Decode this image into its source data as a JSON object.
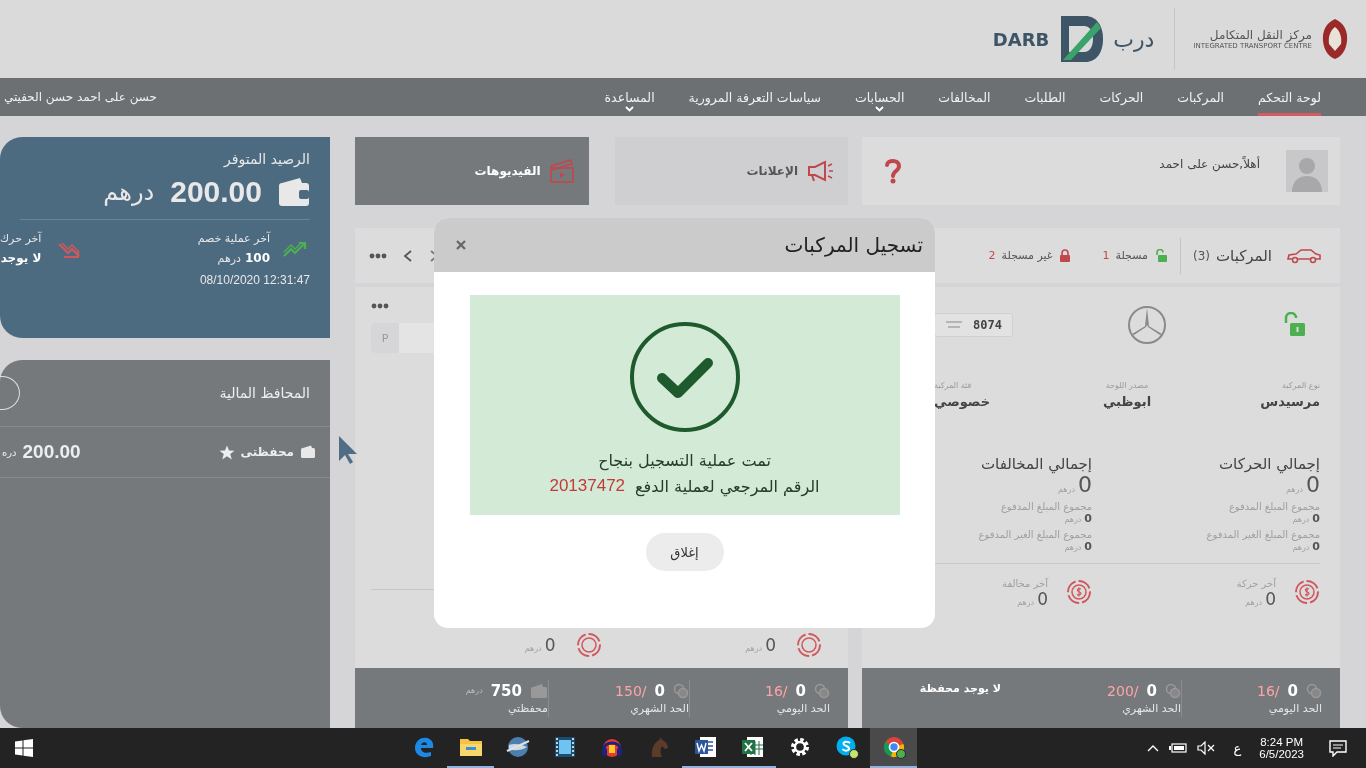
{
  "header": {
    "darb_latin": "DARB",
    "darb_arabic": "درب",
    "itc_arabic": "مركز النقل المتكامل",
    "itc_english": "INTEGRATED TRANSPORT CENTRE"
  },
  "nav": {
    "items": [
      {
        "label": "لوحة التحكم",
        "selected": true,
        "dropdown": false
      },
      {
        "label": "المركبات",
        "selected": false,
        "dropdown": false
      },
      {
        "label": "الحركات",
        "selected": false,
        "dropdown": false
      },
      {
        "label": "الطلبات",
        "selected": false,
        "dropdown": false
      },
      {
        "label": "المخالفات",
        "selected": false,
        "dropdown": false
      },
      {
        "label": "الحسابات",
        "selected": false,
        "dropdown": true
      },
      {
        "label": "سياسات التعرفة المرورية",
        "selected": false,
        "dropdown": false
      },
      {
        "label": "المساعدة",
        "selected": false,
        "dropdown": true
      }
    ],
    "user_name": "حسن على احمد حسن الحفيتي"
  },
  "welcome": {
    "greeting": "أهلاً,حسن على احمد"
  },
  "quick_links": [
    {
      "kind": "announcements",
      "label": "الإعلانات"
    },
    {
      "kind": "videos",
      "label": "الفيديوهات"
    }
  ],
  "vehicles": {
    "title": "المركبات",
    "count": "(3)",
    "registered": {
      "label": "مسجلة",
      "count": "1"
    },
    "unregistered": {
      "label": "غير مسجلة",
      "count": "2"
    },
    "card": {
      "plate": "8074",
      "details": [
        {
          "label": "نوع المركبة",
          "value": "مرسيدس"
        },
        {
          "label": "مصدر اللوحة",
          "value": "ابوظبي"
        },
        {
          "label": "فئة المركبة",
          "value": "خصوصي"
        }
      ],
      "totals": [
        {
          "title": "إجمالي الحركات",
          "value": "0",
          "unit": "درهم",
          "lines": [
            {
              "label": "مجموع المبلغ المدفوع",
              "value": "0",
              "unit": "درهم"
            },
            {
              "label": "مجموع المبلغ الغير المدفوع",
              "value": "0",
              "unit": "درهم"
            }
          ]
        },
        {
          "title": "إجمالي المخالفات",
          "value": "0",
          "unit": "درهم",
          "lines": [
            {
              "label": "مجموع المبلغ المدفوع",
              "value": "0",
              "unit": "درهم"
            },
            {
              "label": "مجموع المبلغ الغير المدفوع",
              "value": "0",
              "unit": "درهم"
            }
          ]
        }
      ],
      "latest": [
        {
          "label": "آخر حركة",
          "value": "0",
          "unit": "درهم"
        },
        {
          "label": "آخر مخالفة",
          "value": "0",
          "unit": "درهم"
        }
      ]
    },
    "limits": [
      {
        "label": "الحد اليومي",
        "value": "0",
        "limit": "16/"
      },
      {
        "label": "الحد الشهري",
        "value": "0",
        "limit": "200/"
      }
    ],
    "wallet_note": "لا يوجد محفظة"
  },
  "middle": {
    "input_prefix": "P",
    "latest": [
      {
        "value": "0",
        "unit": "درهم"
      },
      {
        "value": "0",
        "unit": "درهم"
      }
    ],
    "limits": [
      {
        "label": "الحد اليومي",
        "value": "0",
        "limit": "16/"
      },
      {
        "label": "الحد الشهري",
        "value": "0",
        "limit": "150/"
      }
    ],
    "wallet": {
      "label": "محفظتي",
      "value": "750",
      "unit": "درهم"
    }
  },
  "balance": {
    "title": "الرصيد المتوفر",
    "amount": "200.00",
    "currency": "درهم",
    "last_debit": {
      "label": "آخر عملية خصم",
      "value": "100",
      "unit": "درهم",
      "datetime": "12:31:47 08/10/2020"
    },
    "last_move": {
      "label": "آخر حرك",
      "value": "لا يوجد"
    }
  },
  "wallets": {
    "title": "المحافظ المالية",
    "items": [
      {
        "name": "محفظتى",
        "favorite": true,
        "amount": "200.00",
        "unit": "دره"
      }
    ]
  },
  "modal": {
    "title": "تسجيل المركبات",
    "message": "تمت عملية التسجيل بنجاح",
    "ref_label": "الرقم المرجعي لعملية الدفع",
    "ref_number": "20137472",
    "button": "إغلاق"
  },
  "taskbar": {
    "apps": [
      {
        "kind": "edge",
        "running": false,
        "selected": false
      },
      {
        "kind": "explorer",
        "running": true,
        "selected": false
      },
      {
        "kind": "globe",
        "running": false,
        "selected": false
      },
      {
        "kind": "film",
        "running": false,
        "selected": false
      },
      {
        "kind": "headphones",
        "running": false,
        "selected": false
      },
      {
        "kind": "horse",
        "running": false,
        "selected": false
      },
      {
        "kind": "word",
        "running": true,
        "selected": false
      },
      {
        "kind": "excel",
        "running": true,
        "selected": false
      },
      {
        "kind": "settings",
        "running": false,
        "selected": false
      },
      {
        "kind": "skype",
        "running": false,
        "selected": false
      },
      {
        "kind": "chrome",
        "running": true,
        "selected": true
      }
    ],
    "language": "ع",
    "time": "8:24 PM",
    "date": "6/5/2023"
  }
}
